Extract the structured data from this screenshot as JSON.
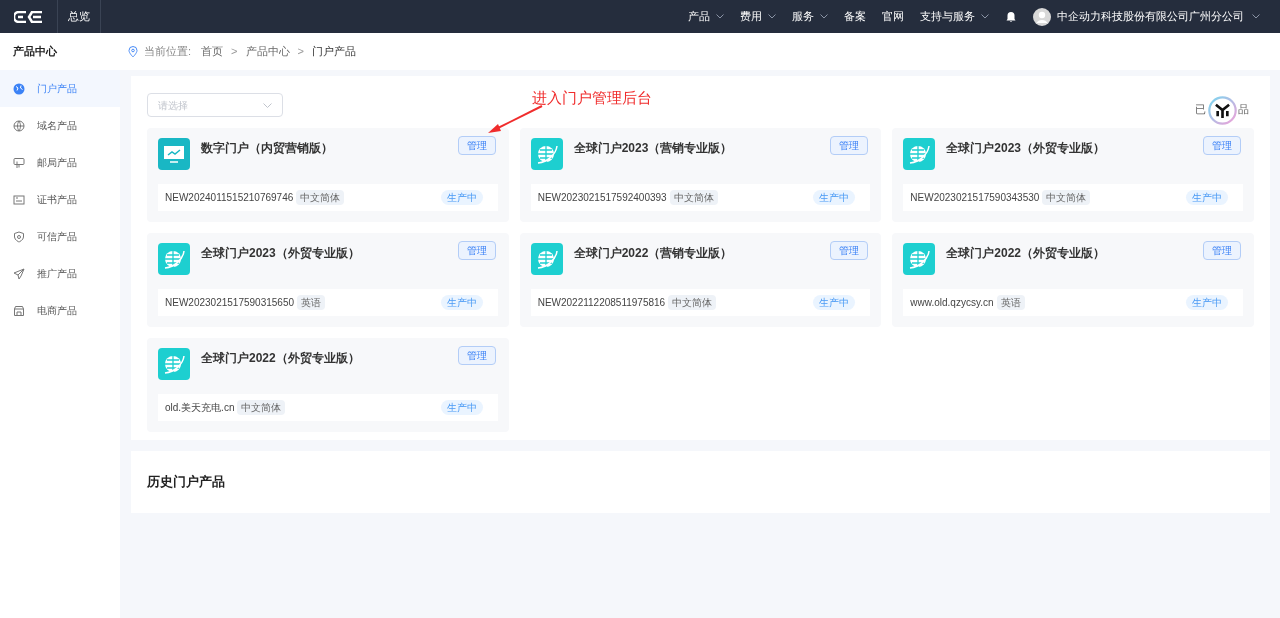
{
  "topbar": {
    "overview": "总览",
    "menu": [
      {
        "label": "产品",
        "dropdown": true
      },
      {
        "label": "费用",
        "dropdown": true
      },
      {
        "label": "服务",
        "dropdown": true
      },
      {
        "label": "备案",
        "dropdown": false
      },
      {
        "label": "官网",
        "dropdown": false
      },
      {
        "label": "支持与服务",
        "dropdown": true
      }
    ],
    "account": "中企动力科技股份有限公司广州分公司"
  },
  "sidebar": {
    "title": "产品中心",
    "items": [
      {
        "label": "门户产品",
        "kind": "globe",
        "selected": true
      },
      {
        "label": "域名产品",
        "kind": "domain",
        "selected": false
      },
      {
        "label": "邮局产品",
        "kind": "mail",
        "selected": false
      },
      {
        "label": "证书产品",
        "kind": "cert",
        "selected": false
      },
      {
        "label": "可信产品",
        "kind": "shield",
        "selected": false
      },
      {
        "label": "推广产品",
        "kind": "plane",
        "selected": false
      },
      {
        "label": "电商产品",
        "kind": "shop",
        "selected": false
      }
    ]
  },
  "breadcrumb": {
    "label": "当前位置:",
    "separators": [
      ">",
      ">"
    ],
    "items": [
      "首页",
      "产品中心",
      "门户产品"
    ]
  },
  "filter": {
    "placeholder": "请选择"
  },
  "annotation": "进入门户管理后台",
  "corner_label_parts": [
    "已",
    "品"
  ],
  "products": [
    {
      "title": "数字门户（内贸营销版）",
      "kind": "monitor",
      "button": "管理",
      "id": "NEW2024011515210769746",
      "lang": "中文简体",
      "status": "生产中"
    },
    {
      "title": "全球门户2023（营销专业版）",
      "kind": "globe",
      "button": "管理",
      "id": "NEW2023021517592400393",
      "lang": "中文简体",
      "status": "生产中"
    },
    {
      "title": "全球门户2023（外贸专业版）",
      "kind": "globe",
      "button": "管理",
      "id": "NEW2023021517590343530",
      "lang": "中文简体",
      "status": "生产中"
    },
    {
      "title": "全球门户2023（外贸专业版）",
      "kind": "globe",
      "button": "管理",
      "id": "NEW2023021517590315650",
      "lang": "英语",
      "status": "生产中"
    },
    {
      "title": "全球门户2022（营销专业版）",
      "kind": "globe",
      "button": "管理",
      "id": "NEW2022112208511975816",
      "lang": "中文简体",
      "status": "生产中"
    },
    {
      "title": "全球门户2022（外贸专业版）",
      "kind": "globe",
      "button": "管理",
      "id": "www.old.qzycsy.cn",
      "lang": "英语",
      "status": "生产中"
    },
    {
      "title": "全球门户2022（外贸专业版）",
      "kind": "globe",
      "button": "管理",
      "id": "old.美天充电.cn",
      "lang": "中文简体",
      "status": "生产中"
    }
  ],
  "history": {
    "title": "历史门户产品"
  }
}
